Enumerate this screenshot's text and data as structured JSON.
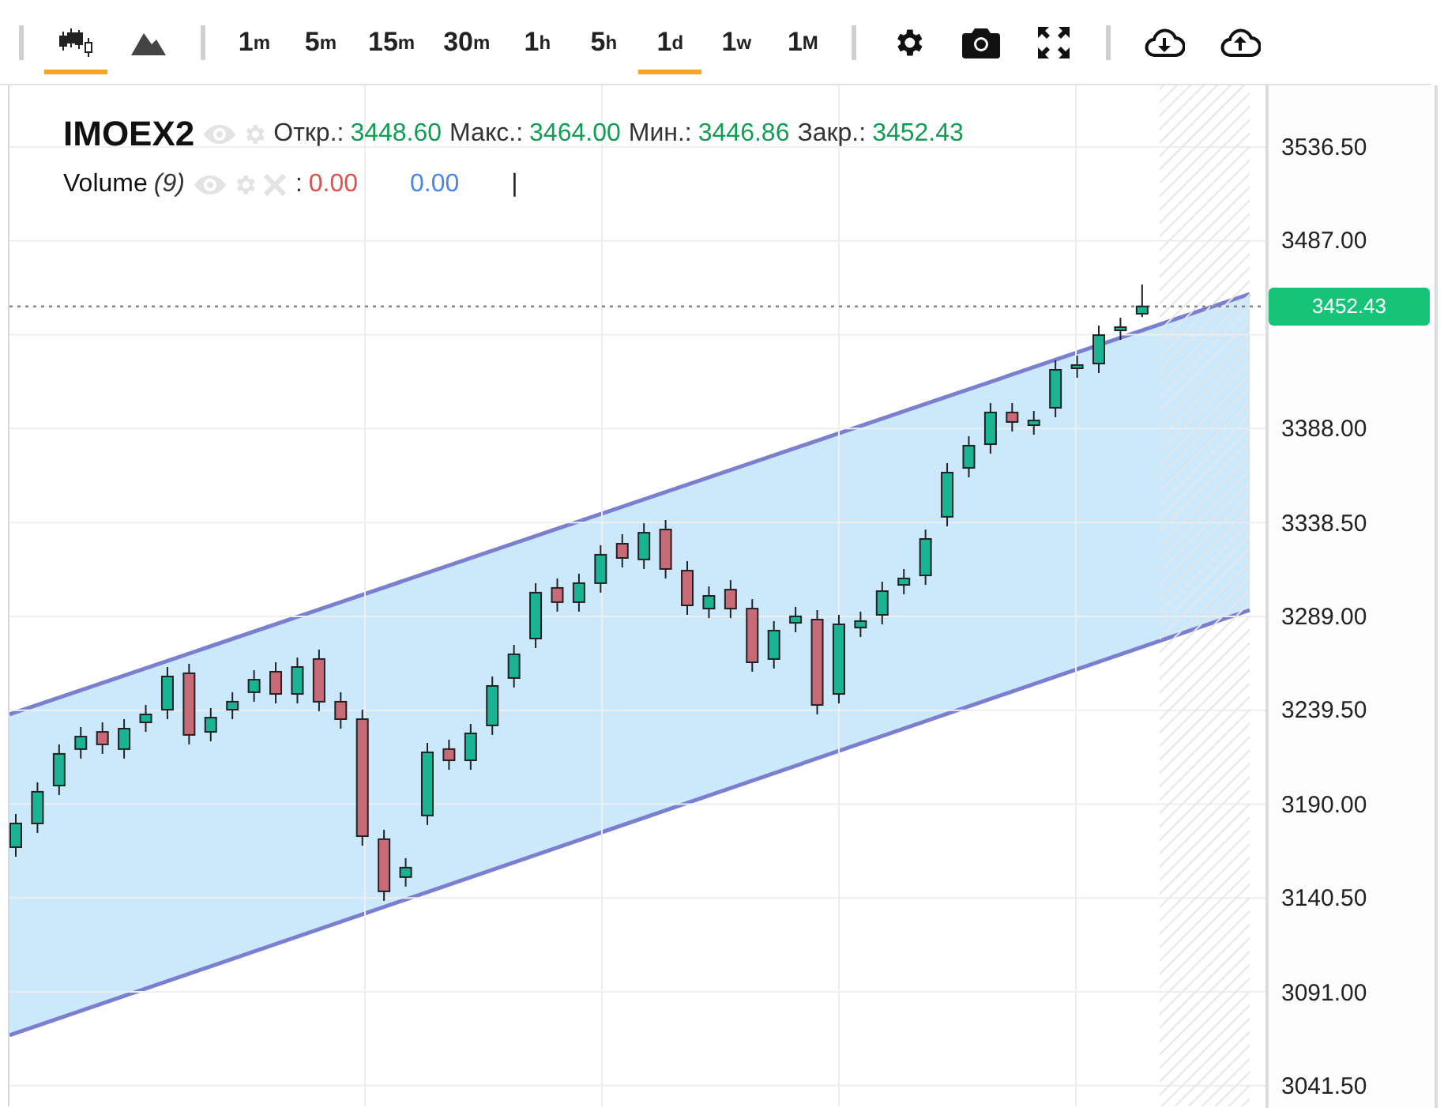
{
  "toolbar": {
    "chart_types": [
      {
        "kind": "candles",
        "selected": true
      },
      {
        "kind": "area",
        "selected": false
      }
    ],
    "timeframes": [
      {
        "value": "1",
        "unit": "m",
        "selected": false
      },
      {
        "value": "5",
        "unit": "m",
        "selected": false
      },
      {
        "value": "15",
        "unit": "m",
        "selected": false
      },
      {
        "value": "30",
        "unit": "m",
        "selected": false
      },
      {
        "value": "1",
        "unit": "h",
        "selected": false
      },
      {
        "value": "5",
        "unit": "h",
        "selected": false
      },
      {
        "value": "1",
        "unit": "d",
        "selected": true
      },
      {
        "value": "1",
        "unit": "w",
        "selected": false
      },
      {
        "value": "1",
        "unit": "M",
        "selected": false
      }
    ],
    "tools": [
      {
        "kind": "settings"
      },
      {
        "kind": "camera"
      },
      {
        "kind": "fullscreen"
      }
    ],
    "transfer": [
      {
        "kind": "download"
      },
      {
        "kind": "upload"
      }
    ]
  },
  "legend": {
    "symbol": "IMOEX2",
    "ohlc": [
      {
        "label": "Откр.:",
        "value": "3448.60"
      },
      {
        "label": "Макс.:",
        "value": "3464.00"
      },
      {
        "label": "Мин.:",
        "value": "3446.86"
      },
      {
        "label": "Закр.:",
        "value": "3452.43"
      }
    ],
    "volume": {
      "name": "Volume",
      "period": "(9)",
      "separator": ":",
      "values": [
        {
          "text": "0.00",
          "color": "#d9534f"
        },
        {
          "text": "0.00",
          "color": "#4a86e8"
        }
      ],
      "cursor": "|"
    }
  },
  "price_axis": {
    "last_price": "3452.43"
  },
  "chart_data": {
    "type": "candlestick",
    "ohlc": [
      [
        3167.3,
        3184.8,
        3162.3,
        3179.8
      ],
      [
        3179.8,
        3201.5,
        3174.8,
        3196.5
      ],
      [
        3199.8,
        3221.5,
        3194.8,
        3216.5
      ],
      [
        3219.0,
        3230.6,
        3214.0,
        3225.6
      ],
      [
        3228.1,
        3233.1,
        3216.5,
        3221.5
      ],
      [
        3219.0,
        3234.8,
        3214.0,
        3229.8
      ],
      [
        3233.1,
        3242.3,
        3228.1,
        3237.3
      ],
      [
        3239.8,
        3262.3,
        3234.8,
        3257.3
      ],
      [
        3259.0,
        3264.0,
        3221.5,
        3226.5
      ],
      [
        3228.1,
        3240.6,
        3223.1,
        3235.6
      ],
      [
        3239.8,
        3249.0,
        3234.8,
        3244.0
      ],
      [
        3249.0,
        3260.6,
        3244.0,
        3255.6
      ],
      [
        3259.8,
        3264.8,
        3243.1,
        3248.1
      ],
      [
        3248.1,
        3267.3,
        3243.1,
        3262.3
      ],
      [
        3266.5,
        3271.5,
        3239.0,
        3244.0
      ],
      [
        3244.0,
        3249.0,
        3229.8,
        3234.8
      ],
      [
        3234.8,
        3239.8,
        3168.1,
        3173.1
      ],
      [
        3171.5,
        3176.5,
        3139.0,
        3144.0
      ],
      [
        3151.5,
        3161.5,
        3146.5,
        3156.5
      ],
      [
        3184.0,
        3222.3,
        3179.0,
        3217.3
      ],
      [
        3219.0,
        3224.0,
        3208.1,
        3213.1
      ],
      [
        3213.1,
        3232.3,
        3208.1,
        3227.3
      ],
      [
        3231.5,
        3257.3,
        3226.5,
        3252.3
      ],
      [
        3256.5,
        3274.0,
        3251.5,
        3269.0
      ],
      [
        3277.3,
        3306.5,
        3272.3,
        3301.5
      ],
      [
        3304.0,
        3309.0,
        3291.5,
        3296.5
      ],
      [
        3296.5,
        3311.5,
        3291.5,
        3306.5
      ],
      [
        3306.5,
        3326.5,
        3301.5,
        3321.5
      ],
      [
        3327.3,
        3332.3,
        3314.8,
        3319.8
      ],
      [
        3319.0,
        3338.1,
        3314.0,
        3333.1
      ],
      [
        3334.8,
        3339.8,
        3309.0,
        3314.0
      ],
      [
        3313.1,
        3318.1,
        3289.8,
        3294.8
      ],
      [
        3293.1,
        3304.8,
        3288.1,
        3299.8
      ],
      [
        3303.1,
        3308.1,
        3288.1,
        3293.1
      ],
      [
        3293.1,
        3298.1,
        3259.8,
        3264.8
      ],
      [
        3266.5,
        3286.5,
        3261.5,
        3281.5
      ],
      [
        3285.6,
        3294.0,
        3280.6,
        3289.0
      ],
      [
        3287.3,
        3292.3,
        3237.3,
        3242.3
      ],
      [
        3248.1,
        3289.8,
        3243.1,
        3284.8
      ],
      [
        3283.1,
        3291.5,
        3278.1,
        3286.5
      ],
      [
        3289.8,
        3307.3,
        3284.8,
        3302.3
      ],
      [
        3305.6,
        3314.0,
        3300.6,
        3309.0
      ],
      [
        3310.6,
        3334.8,
        3305.6,
        3329.8
      ],
      [
        3341.5,
        3369.8,
        3336.5,
        3364.8
      ],
      [
        3367.3,
        3384.0,
        3362.3,
        3379.0
      ],
      [
        3379.8,
        3401.5,
        3374.8,
        3396.5
      ],
      [
        3396.5,
        3401.5,
        3386.5,
        3391.5
      ],
      [
        3389.8,
        3397.3,
        3384.8,
        3392.3
      ],
      [
        3399.0,
        3424.0,
        3394.0,
        3419.0
      ],
      [
        3419.8,
        3426.5,
        3414.8,
        3421.5
      ],
      [
        3422.3,
        3442.3,
        3417.3,
        3437.3
      ],
      [
        3439.8,
        3446.5,
        3434.8,
        3441.5
      ],
      [
        3448.6,
        3464.0,
        3446.86,
        3452.43
      ]
    ],
    "ylim": [
      3030.6,
      3569.0
    ],
    "grid": true,
    "ref_lines": [
      {
        "axis": "y",
        "value": 3452.43,
        "color": "#888888"
      }
    ],
    "yticks": [
      {
        "value": 3536.5,
        "label": "3536.50"
      },
      {
        "value": 3487,
        "label": "3487.00"
      },
      {
        "value": 3388,
        "label": "3388.00"
      },
      {
        "value": 3338.5,
        "label": "3338.50"
      },
      {
        "value": 3289,
        "label": "3289.00"
      },
      {
        "value": 3239.5,
        "label": "3239.50"
      },
      {
        "value": 3190,
        "label": "3190.00"
      },
      {
        "value": 3140.5,
        "label": "3140.50"
      },
      {
        "value": 3091,
        "label": "3091.00"
      },
      {
        "value": 3041.5,
        "label": "3041.50"
      }
    ]
  }
}
